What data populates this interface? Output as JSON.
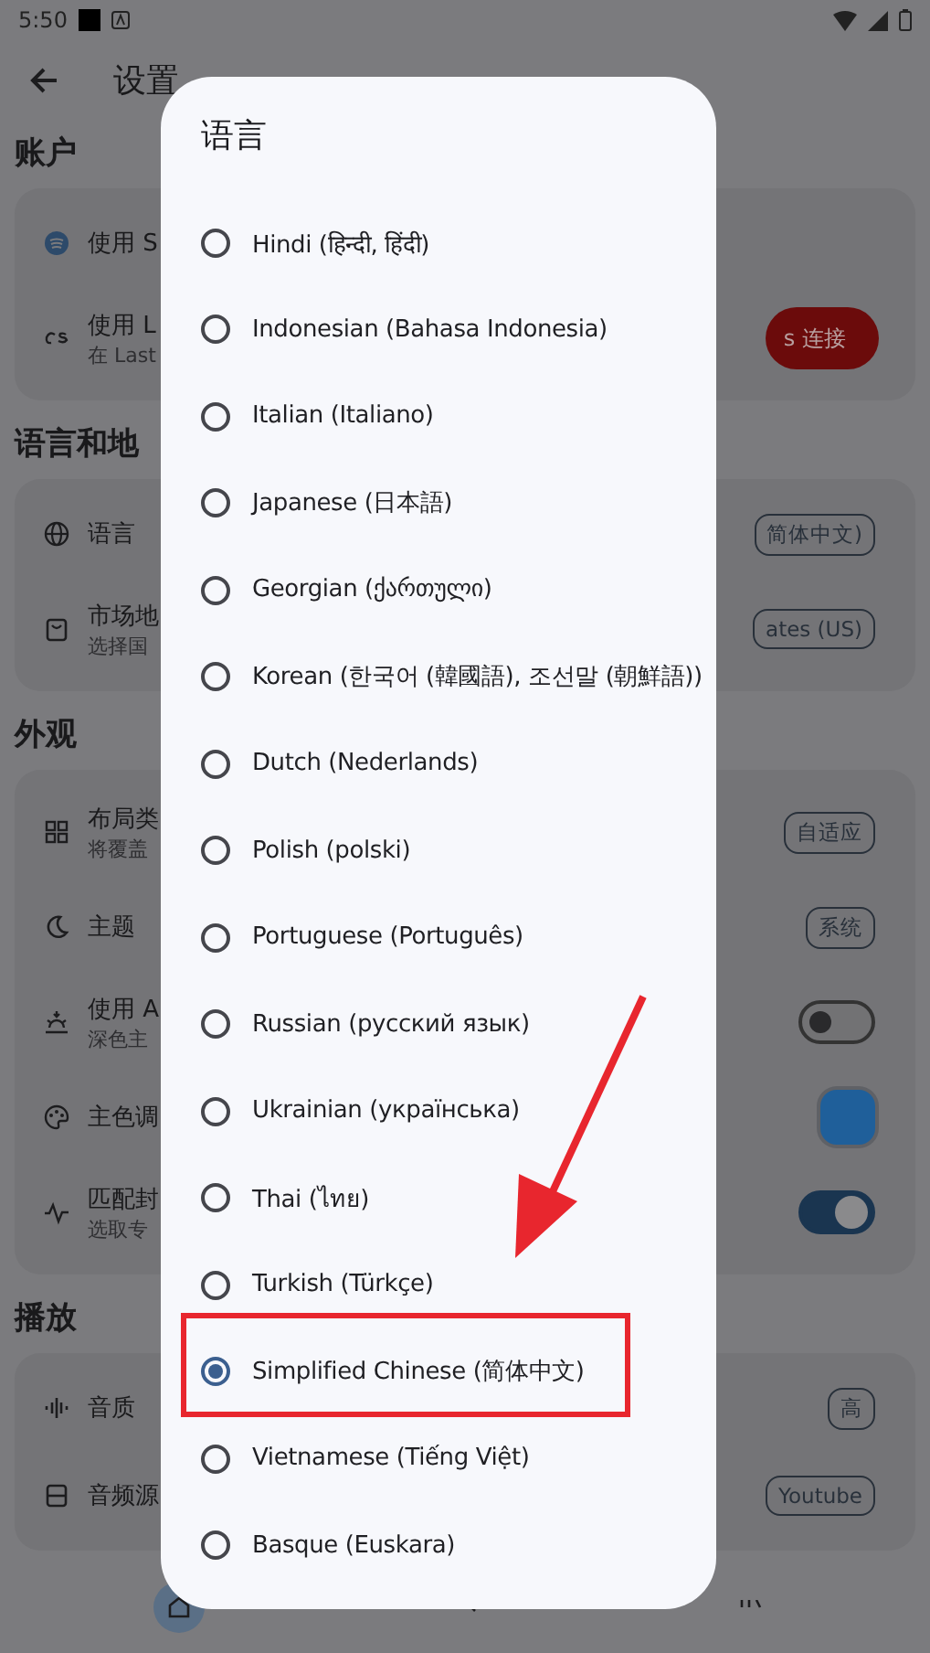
{
  "status_bar": {
    "time": "5:50"
  },
  "app_bar": {
    "title": "设置"
  },
  "sections": [
    {
      "title": "账户",
      "rows": [
        {
          "kind": "plain",
          "label": "使用 S"
        },
        {
          "kind": "button",
          "label": "使用 L",
          "sublabel": "在 Last",
          "value": "s 连接"
        }
      ]
    },
    {
      "title": "语言和地",
      "rows": [
        {
          "kind": "chip",
          "label": "语言",
          "value": "简体中文)"
        },
        {
          "kind": "chip",
          "label": "市场地",
          "sublabel": "选择国",
          "value": "ates (US)"
        }
      ]
    },
    {
      "title": "外观",
      "rows": [
        {
          "kind": "chip",
          "label": "布局类",
          "sublabel": "将覆盖",
          "value": "自适应"
        },
        {
          "kind": "chip",
          "label": "主题",
          "value": "系统"
        },
        {
          "kind": "toggle",
          "label": "使用 A",
          "sublabel": "深色主",
          "on": false
        },
        {
          "kind": "swatch",
          "label": "主色调",
          "color": "#1f5f9a"
        },
        {
          "kind": "toggle",
          "label": "匹配封",
          "sublabel": "选取专",
          "on": true
        }
      ]
    },
    {
      "title": "播放",
      "rows": [
        {
          "kind": "chip",
          "label": "音质",
          "value": "高"
        },
        {
          "kind": "chip",
          "label": "音频源",
          "value": "Youtube"
        }
      ]
    }
  ],
  "bottom_nav": [
    {
      "selected": true
    },
    {
      "selected": false
    },
    {
      "selected": false
    }
  ],
  "dialog": {
    "title": "语言",
    "options": [
      {
        "label": "Hindi (हिन्दी, हिंदी)",
        "selected": false
      },
      {
        "label": "Indonesian (Bahasa Indonesia)",
        "selected": false
      },
      {
        "label": "Italian (Italiano)",
        "selected": false
      },
      {
        "label": "Japanese (日本語)",
        "selected": false
      },
      {
        "label": "Georgian (ქართული)",
        "selected": false
      },
      {
        "label": "Korean (한국어 (韓國語), 조선말 (朝鮮語))",
        "selected": false
      },
      {
        "label": "Dutch (Nederlands)",
        "selected": false
      },
      {
        "label": "Polish (polski)",
        "selected": false
      },
      {
        "label": "Portuguese (Português)",
        "selected": false
      },
      {
        "label": "Russian (русский язык)",
        "selected": false
      },
      {
        "label": "Ukrainian (українська)",
        "selected": false
      },
      {
        "label": "Thai (ไทย)",
        "selected": false
      },
      {
        "label": "Turkish (Türkçe)",
        "selected": false
      },
      {
        "label": "Simplified Chinese (简体中文)",
        "selected": true
      },
      {
        "label": "Vietnamese (Tiếng Việt)",
        "selected": false
      },
      {
        "label": "Basque (Euskara)",
        "selected": false
      }
    ]
  }
}
